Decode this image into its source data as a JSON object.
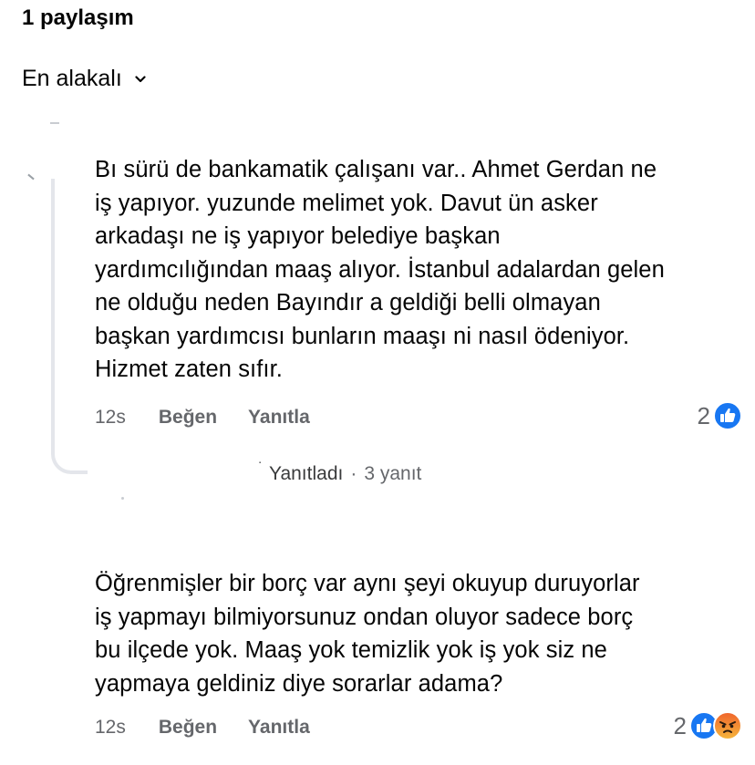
{
  "header": {
    "share_count": "1 paylaşım",
    "sort_label": "En alakalı"
  },
  "comments": [
    {
      "text": "Bı sürü de bankamatik çalışanı var.. Ahmet Gerdan ne\niş yapıyor. yuzunde melimet yok. Davut ün asker\narkadaşı ne iş yapıyor belediye başkan\nyardımcılığından maaş alıyor. İstanbul adalardan gelen\nne olduğu neden Bayındır a geldiği belli olmayan\nbaşkan yardımcısı bunların maaşı ni nasıl ödeniyor.\nHizmet zaten sıfır.",
      "time": "12s",
      "like_label": "Beğen",
      "reply_label": "Yanıtla",
      "reaction_count": "2",
      "reactions": [
        "like-icon"
      ],
      "replies": {
        "lead": "˙",
        "label": "Yanıtladı",
        "separator": "·",
        "count": "3 yanıt"
      }
    },
    {
      "text": "Öğrenmişler bir borç var aynı şeyi okuyup duruyorlar\niş yapmayı bilmiyorsunuz ondan oluyor sadece borç\nbu ilçede yok. Maaş yok temizlik yok iş yok siz ne\nyapmaya geldiniz diye sorarlar adama?",
      "time": "12s",
      "like_label": "Beğen",
      "reply_label": "Yanıtla",
      "reaction_count": "2",
      "reactions": [
        "like-icon",
        "angry-icon"
      ]
    }
  ],
  "colors": {
    "like_blue": "#1877f2",
    "angry_orange": "#f0642c",
    "secondary_text": "#65676b"
  }
}
